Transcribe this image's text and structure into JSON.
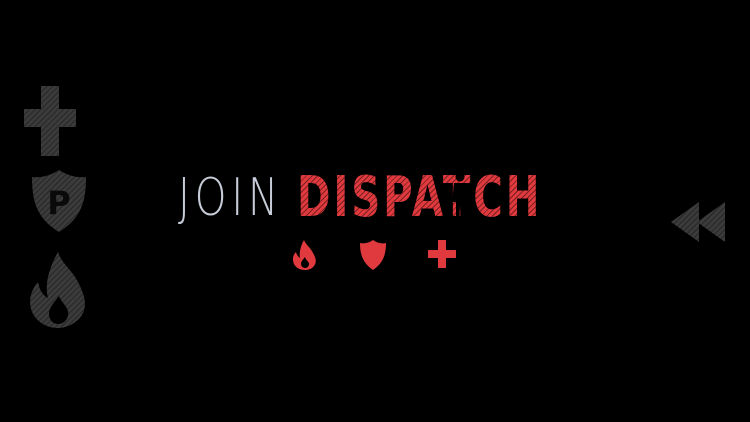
{
  "app": {
    "logo_part1": "JOIN",
    "logo_part2": "DISPATCH"
  },
  "sidebar": {
    "items": [
      {
        "icon": "medical-cross-icon"
      },
      {
        "icon": "police-badge-icon",
        "letter": "P"
      },
      {
        "icon": "flame-icon"
      }
    ]
  },
  "service_icons": [
    {
      "icon": "flame-icon"
    },
    {
      "icon": "police-badge-icon"
    },
    {
      "icon": "medical-cross-icon"
    }
  ],
  "rewind": {
    "icon": "rewind-icon"
  },
  "colors": {
    "background": "#000000",
    "accent_red": "#e03a3f",
    "logo_light": "#c7ccd9",
    "side_icon_gray": "#3a3a3a"
  }
}
